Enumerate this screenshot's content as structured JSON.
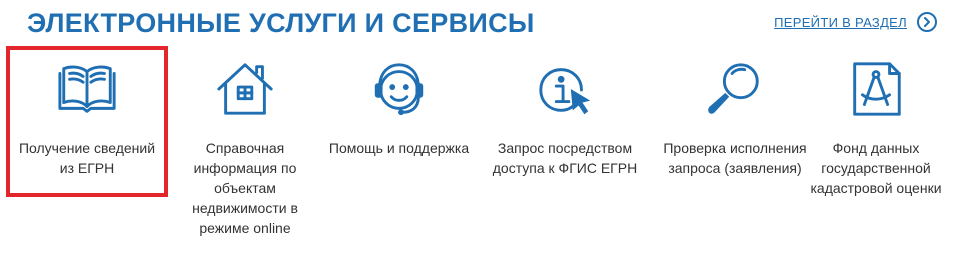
{
  "header": {
    "title": "ЭЛЕКТРОННЫЕ УСЛУГИ И СЕРВИСЫ",
    "section_link": "ПЕРЕЙТИ В РАЗДЕЛ",
    "section_link_icon": "chevron-right-circle-icon"
  },
  "services": [
    {
      "label": "Получение сведений из ЕГРН",
      "icon": "book-icon",
      "selected": true
    },
    {
      "label": "Справочная информация по объектам недвижимости в режиме online",
      "icon": "house-icon"
    },
    {
      "label": "Помощь и поддержка",
      "icon": "support-headset-icon"
    },
    {
      "label": "Запрос посредством доступа к ФГИС ЕГРН",
      "icon": "info-cursor-icon"
    },
    {
      "label": "Проверка исполнения запроса (заявления)",
      "icon": "magnifier-icon"
    },
    {
      "label": "Фонд данных государственной кадастровой оценки",
      "icon": "drafting-compass-document-icon"
    }
  ],
  "colors": {
    "accent": "#1f6fb2",
    "selection": "#e3262b"
  }
}
